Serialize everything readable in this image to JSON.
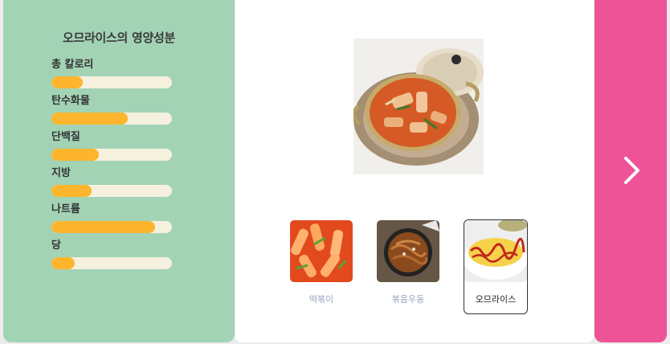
{
  "nutrition": {
    "title": "오므라이스의 영양성분",
    "items": [
      {
        "label": "총 칼로리",
        "level": 0.26
      },
      {
        "label": "탄수화물",
        "level": 0.63
      },
      {
        "label": "단백질",
        "level": 0.39
      },
      {
        "label": "지방",
        "level": 0.33
      },
      {
        "label": "나트륨",
        "level": 0.86
      },
      {
        "label": "당",
        "level": 0.19
      }
    ]
  },
  "foods": [
    {
      "label": "떡볶이",
      "selected": false
    },
    {
      "label": "볶음우동",
      "selected": false
    },
    {
      "label": "오므라이스",
      "selected": true
    }
  ],
  "colors": {
    "panel": "#a3d3b5",
    "bar_fill": "#fcb52d",
    "bar_track": "#f6f1df",
    "next": "#ee5397"
  },
  "icons": {
    "next": "chevron-right-icon"
  }
}
